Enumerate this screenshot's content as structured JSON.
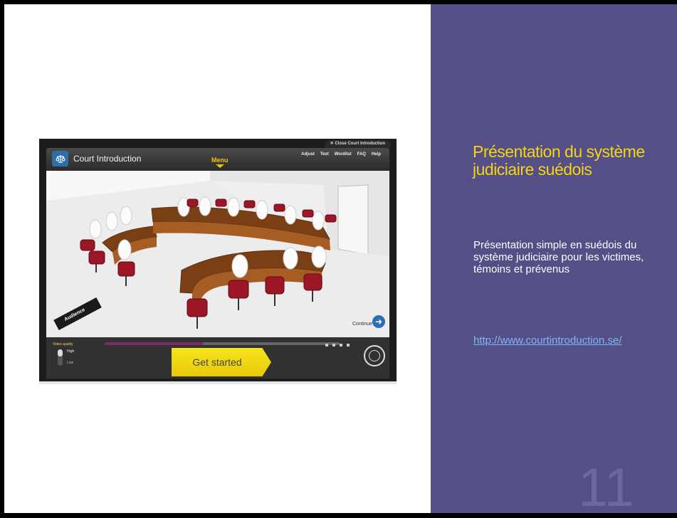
{
  "slide": {
    "title": "Présentation du système judiciaire suédois",
    "body": "Présentation simple en suédois du système judiciaire pour les victimes, témoins et prévenus",
    "link": "http://www.courtintroduction.se/",
    "number": "11"
  },
  "app": {
    "title": "Court Introduction",
    "close_tab": "✕  Close Court Introduction",
    "menu_label": "Menu",
    "top_menu": [
      "Adjust",
      "Text",
      "Wordlist",
      "FAQ",
      "Help"
    ],
    "audience_label": "Audience",
    "continue_label": "Continue",
    "video_quality_label": "Video quality",
    "quality_high": "High",
    "quality_low": "Low",
    "get_started_label": "Get started",
    "timeline_progress": 0.42
  },
  "colors": {
    "panel": "#544f87",
    "title": "#f5d415",
    "link": "#7fb8ee",
    "button": "#f1d90f"
  }
}
